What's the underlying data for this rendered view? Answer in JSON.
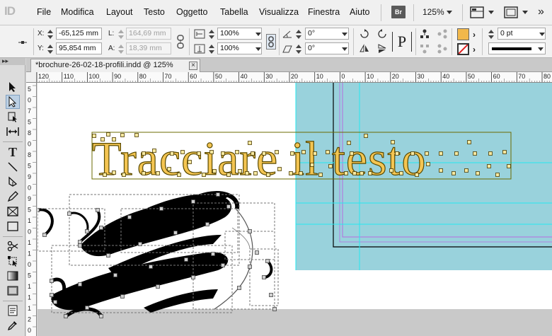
{
  "app": {
    "logo": "ID",
    "menu": [
      "File",
      "Modifica",
      "Layout",
      "Testo",
      "Oggetto",
      "Tabella",
      "Visualizza",
      "Finestra",
      "Aiuto"
    ],
    "bridge_badge": "Br",
    "zoom_level": "125%"
  },
  "control_panel": {
    "x_label": "X:",
    "x_value": "-65,125 mm",
    "y_label": "Y:",
    "y_value": "95,854 mm",
    "w_label": "L:",
    "w_value": "164,69 mm",
    "h_label": "A:",
    "h_value": "18,39 mm",
    "scale_x": "100%",
    "scale_y": "100%",
    "rotation": "0°",
    "shear": "0°",
    "stroke_weight": "0 pt",
    "fill_color": "#f2b84b",
    "stroke_color": "#000000"
  },
  "document": {
    "tab_title": "*brochure-26-02-18-profili.indd @ 125%",
    "close_glyph": "×"
  },
  "ruler_h_labels": [
    "120",
    "110",
    "100",
    "90",
    "80",
    "70",
    "60",
    "50",
    "40",
    "30",
    "20",
    "10",
    "0",
    "10",
    "20",
    "30",
    "40",
    "50",
    "60",
    "70",
    "80"
  ],
  "ruler_v_labels": [
    "5",
    "0",
    "7",
    "5",
    "8",
    "0",
    "8",
    "5",
    "9",
    "0",
    "9",
    "5",
    "1",
    "0",
    "1",
    "1",
    "0",
    "5",
    "1",
    "1",
    "1",
    "2",
    "0"
  ],
  "canvas": {
    "headline": "Tracciare il testo",
    "headline_fill": "#f4c552",
    "spread_color": "#99d2dc",
    "guide_color": "#25e8f0",
    "margin_color": "#b86be0"
  }
}
